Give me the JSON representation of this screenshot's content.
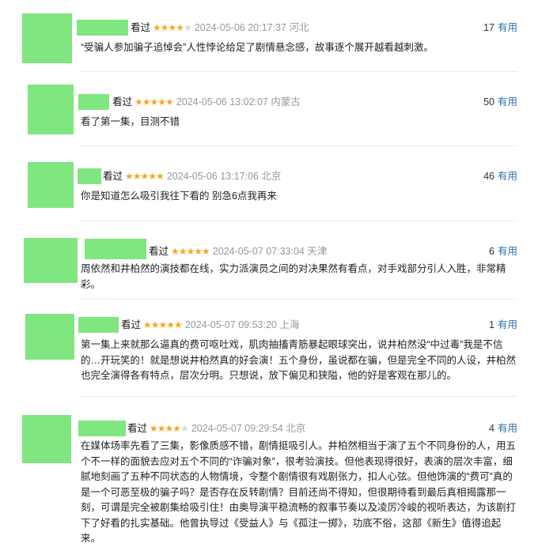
{
  "vote_label": "有用",
  "reviews": [
    {
      "watched": "看过",
      "rating": 4,
      "time": "2024-05-06 20:17:37",
      "location": "河北",
      "votes": "17",
      "content": "“受骗人参加骗子追悼会”人性悖论给足了剧情悬念感，故事逐个展开越看越刺激。"
    },
    {
      "watched": "看过",
      "rating": 5,
      "time": "2024-05-06 13:02:07",
      "location": "内蒙古",
      "votes": "50",
      "content": "看了第一集，目测不错"
    },
    {
      "watched": "看过",
      "rating": 5,
      "time": "2024-05-06 13:17:06",
      "location": "北京",
      "votes": "46",
      "content": "你是知道怎么吸引我往下看的 别急6点我再来"
    },
    {
      "watched": "看过",
      "rating": 5,
      "time": "2024-05-07 07:33:04",
      "location": "天津",
      "votes": "6",
      "content": "周依然和井柏然的演技都在线，实力派演员之间的对决果然有看点，对手戏部分引人入胜，非常精彩。"
    },
    {
      "watched": "看过",
      "rating": 5,
      "time": "2024-05-07 09:53:20",
      "location": "上海",
      "votes": "1",
      "content": "第一集上来就那么逼真的费可呕吐戏，肌肉抽搐青筋暴起眼球突出，说井柏然没“中过毒”我是不信的…开玩笑的！就是想说井柏然真的好会演！五个身份，虽说都在骗，但是完全不同的人设，井柏然也完全演得各有特点，层次分明。只想说，放下偏见和狭隘，他的好是客观在那儿的。"
    },
    {
      "watched": "看过",
      "rating": 4,
      "time": "2024-05-07 09:29:54",
      "location": "北京",
      "votes": "4",
      "content": "在媒体场率先看了三集，影像质感不错，剧情挺吸引人。井柏然相当于演了五个不同身份的人，用五个不一样的面貌去应对五个不同的“诈骗对象”，很考验演技。但他表现得很好，表演的层次丰富，细腻地刻画了五种不同状态的人物情境，令整个剧情很有戏剧张力，扣人心弦。但他饰演的“费可”真的是一个可恶至极的骗子吗？是否存在反转剧情？目前还尚不得知，但很期待看到最后真相揭露那一刻，可谓是完全被剧集给吸引住！由奥导演平稳流畅的叙事节奏以及凌厉冷峻的视听表达，为该剧打下了好看的扎实基础。他曾执导过《受益人》与《孤注一掷》，功底不俗，这部《新生》值得追起来。"
    }
  ]
}
